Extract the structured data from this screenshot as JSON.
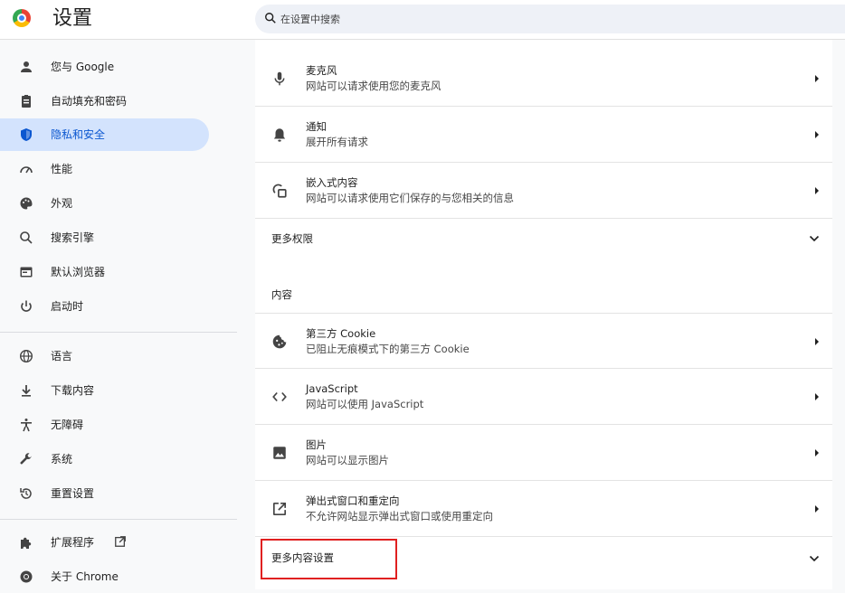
{
  "header": {
    "title": "设置",
    "search_placeholder": "在设置中搜索"
  },
  "sidebar": {
    "items": [
      {
        "label": "您与 Google",
        "icon": "person-icon"
      },
      {
        "label": "自动填充和密码",
        "icon": "clipboard-icon"
      },
      {
        "label": "隐私和安全",
        "icon": "shield-icon",
        "active": true
      },
      {
        "label": "性能",
        "icon": "speedometer-icon"
      },
      {
        "label": "外观",
        "icon": "palette-icon"
      },
      {
        "label": "搜索引擎",
        "icon": "search-icon"
      },
      {
        "label": "默认浏览器",
        "icon": "browser-icon"
      },
      {
        "label": "启动时",
        "icon": "power-icon"
      },
      {
        "label": "语言",
        "icon": "globe-icon"
      },
      {
        "label": "下载内容",
        "icon": "download-icon"
      },
      {
        "label": "无障碍",
        "icon": "accessibility-icon"
      },
      {
        "label": "系统",
        "icon": "wrench-icon"
      },
      {
        "label": "重置设置",
        "icon": "reset-icon"
      },
      {
        "label": "扩展程序",
        "icon": "puzzle-icon"
      },
      {
        "label": "关于 Chrome",
        "icon": "chrome-icon"
      }
    ]
  },
  "main": {
    "rows": [
      {
        "title": "麦克风",
        "subtitle": "网站可以请求使用您的麦克风",
        "icon": "microphone-icon"
      },
      {
        "title": "通知",
        "subtitle": "展开所有请求",
        "icon": "bell-icon"
      },
      {
        "title": "嵌入式内容",
        "subtitle": "网站可以请求使用它们保存的与您相关的信息",
        "icon": "embedded-content-icon"
      }
    ],
    "more_permissions": "更多权限",
    "content_section": "内容",
    "content_rows": [
      {
        "title": "第三方 Cookie",
        "subtitle": "已阻止无痕模式下的第三方 Cookie",
        "icon": "cookie-icon"
      },
      {
        "title": "JavaScript",
        "subtitle": "网站可以使用 JavaScript",
        "icon": "code-icon"
      },
      {
        "title": "图片",
        "subtitle": "网站可以显示图片",
        "icon": "image-icon"
      },
      {
        "title": "弹出式窗口和重定向",
        "subtitle": "不允许网站显示弹出式窗口或使用重定向",
        "icon": "popup-icon"
      }
    ],
    "more_content_settings": "更多内容设置"
  },
  "colors": {
    "active_bg": "#d3e3fd",
    "active_text": "#0b57d0",
    "highlight_border": "#e02020"
  }
}
